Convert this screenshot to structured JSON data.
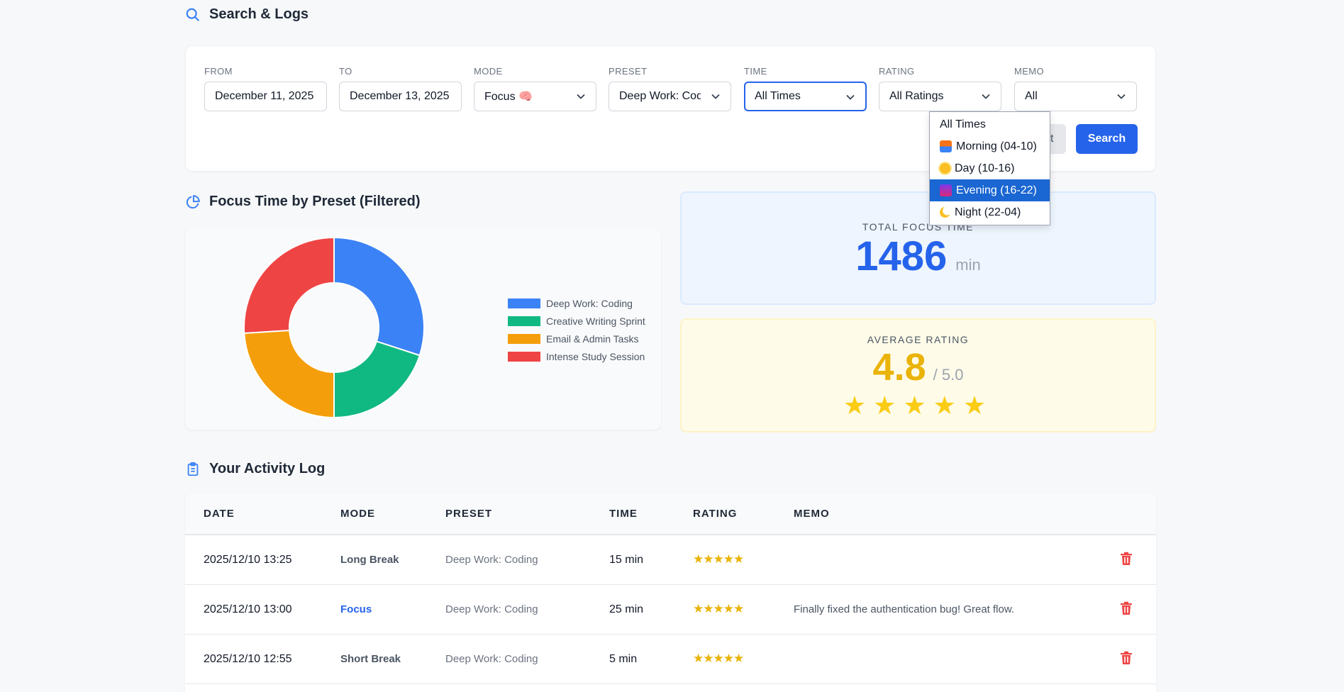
{
  "search_section": {
    "title": "Search & Logs"
  },
  "filters": {
    "from": {
      "label": "FROM",
      "value": "December 11, 2025"
    },
    "to": {
      "label": "TO",
      "value": "December 13, 2025"
    },
    "mode": {
      "label": "MODE",
      "value": "Focus 🧠"
    },
    "preset": {
      "label": "PRESET",
      "value": "Deep Work: Coding"
    },
    "time": {
      "label": "TIME",
      "value": "All Times"
    },
    "rating": {
      "label": "RATING",
      "value": "All Ratings"
    },
    "memo": {
      "label": "MEMO",
      "value": "All"
    },
    "reset_label": "Reset",
    "search_label": "Search"
  },
  "time_dropdown": {
    "options": [
      {
        "label": "All Times",
        "icon": ""
      },
      {
        "label": "Morning (04-10)",
        "icon": "sunrise-icon"
      },
      {
        "label": "Day (10-16)",
        "icon": "sun-icon"
      },
      {
        "label": "Evening (16-22)",
        "icon": "city-dusk-icon"
      },
      {
        "label": "Night (22-04)",
        "icon": "crescent-moon-icon"
      }
    ],
    "highlighted": "Evening (16-22)"
  },
  "chart_section": {
    "title": "Focus Time by Preset (Filtered)"
  },
  "chart_data": {
    "type": "pie",
    "donut": true,
    "title": "",
    "categories": [
      "Deep Work: Coding",
      "Creative Writing Sprint",
      "Email & Admin Tasks",
      "Intense Study Session"
    ],
    "values": [
      30,
      20,
      24,
      26
    ],
    "colors": [
      "#3b82f6",
      "#10b981",
      "#f59e0b",
      "#ef4444"
    ],
    "legend_position": "right"
  },
  "total_focus": {
    "caption": "TOTAL FOCUS TIME",
    "value": "1486",
    "unit": "min"
  },
  "average_rating": {
    "caption": "AVERAGE RATING",
    "value": "4.8",
    "max": "/ 5.0",
    "stars": "★★★★★"
  },
  "activity_section": {
    "title": "Your Activity Log"
  },
  "table": {
    "columns": [
      "DATE",
      "MODE",
      "PRESET",
      "TIME",
      "RATING",
      "MEMO"
    ],
    "rows": [
      {
        "date": "2025/12/10 13:25",
        "mode": "Long Break",
        "preset": "Deep Work: Coding",
        "time": "15 min",
        "rating": "★★★★★",
        "memo": ""
      },
      {
        "date": "2025/12/10 13:00",
        "mode": "Focus",
        "preset": "Deep Work: Coding",
        "time": "25 min",
        "rating": "★★★★★",
        "memo": "Finally fixed the authentication bug! Great flow."
      },
      {
        "date": "2025/12/10 12:55",
        "mode": "Short Break",
        "preset": "Deep Work: Coding",
        "time": "5 min",
        "rating": "★★★★★",
        "memo": ""
      }
    ]
  },
  "colors": {
    "accent": "#2563eb",
    "danger": "#ef4444",
    "star": "#eab308"
  }
}
